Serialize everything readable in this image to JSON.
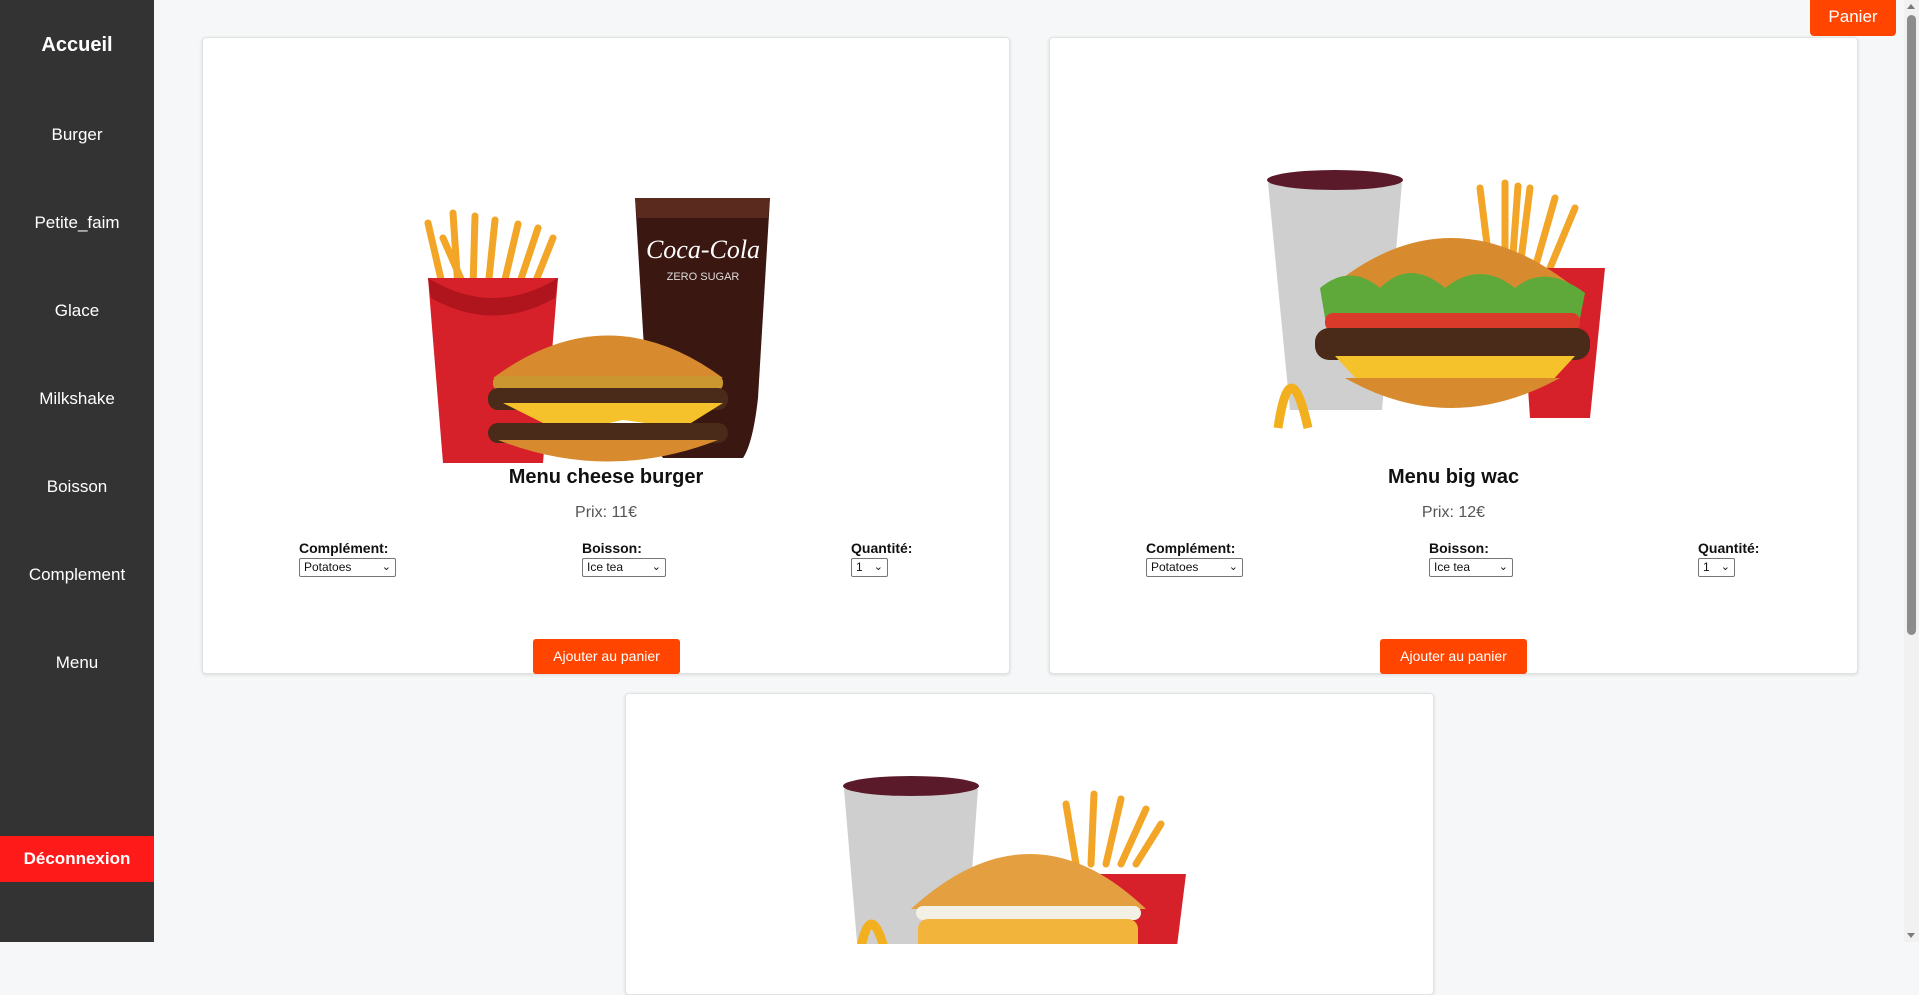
{
  "sidebar": {
    "home": "Accueil",
    "items": [
      "Burger",
      "Petite_faim",
      "Glace",
      "Milkshake",
      "Boisson",
      "Complement",
      "Menu"
    ],
    "logout": "Déconnexion"
  },
  "header": {
    "cart": "Panier"
  },
  "products": [
    {
      "name": "Menu cheese burger",
      "price": "Prix: 11€",
      "complement_label": "Complément:",
      "complement_value": "Potatoes",
      "drink_label": "Boisson:",
      "drink_value": "Ice tea",
      "qty_label": "Quantité:",
      "qty_value": "1",
      "add_label": "Ajouter au panier"
    },
    {
      "name": "Menu big wac",
      "price": "Prix: 12€",
      "complement_label": "Complément:",
      "complement_value": "Potatoes",
      "drink_label": "Boisson:",
      "drink_value": "Ice tea",
      "qty_label": "Quantité:",
      "qty_value": "1",
      "add_label": "Ajouter au panier"
    }
  ],
  "image_text": {
    "cola_logo": "Coca-Cola",
    "cola_sub": "ZERO SUGAR"
  },
  "colors": {
    "accent": "#ff4500",
    "sidebar": "#333333",
    "logout": "#ff1a1a"
  }
}
